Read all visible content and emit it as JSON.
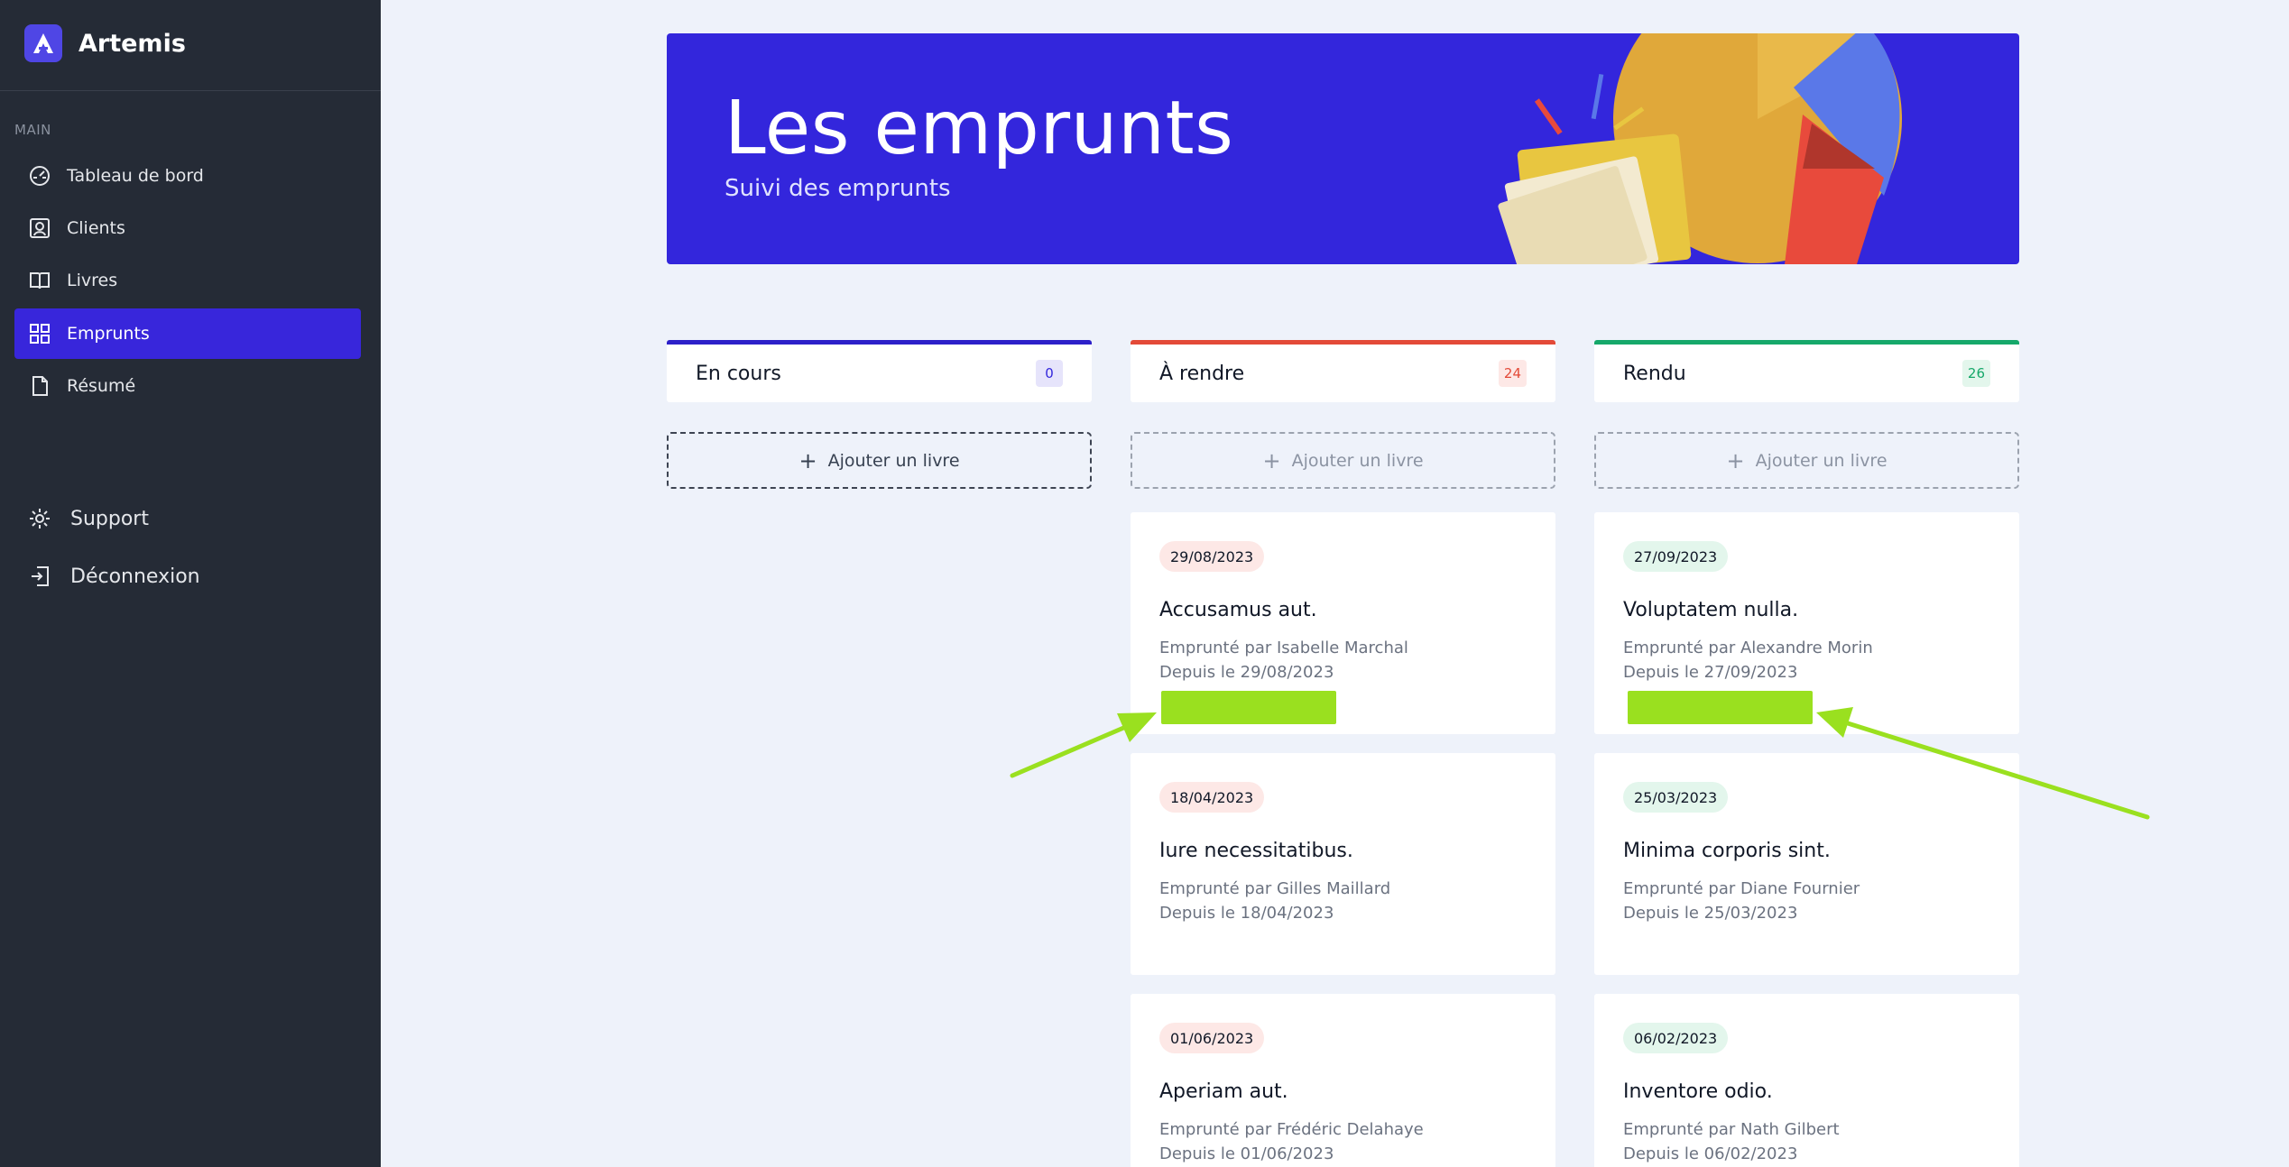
{
  "app": {
    "name": "Artemis",
    "logo_icon": "artemis-logo-icon"
  },
  "sidebar": {
    "section_label": "MAIN",
    "items": [
      {
        "label": "Tableau de bord",
        "icon": "dashboard-icon",
        "active": false
      },
      {
        "label": "Clients",
        "icon": "user-icon",
        "active": false
      },
      {
        "label": "Livres",
        "icon": "book-icon",
        "active": false
      },
      {
        "label": "Emprunts",
        "icon": "grid-icon",
        "active": true
      },
      {
        "label": "Résumé",
        "icon": "document-icon",
        "active": false
      }
    ],
    "bottom": [
      {
        "label": "Support",
        "icon": "gear-icon"
      },
      {
        "label": "Déconnexion",
        "icon": "logout-icon"
      }
    ]
  },
  "banner": {
    "title": "Les emprunts",
    "subtitle": "Suivi des emprunts"
  },
  "columns": [
    {
      "title": "En cours",
      "count": "0",
      "accent": "#2d20c9",
      "add_label": "Ajouter un livre",
      "cards": []
    },
    {
      "title": "À rendre",
      "count": "24",
      "accent": "#e34a38",
      "add_label": "Ajouter un livre",
      "cards": [
        {
          "date": "29/08/2023",
          "title": "Accusamus aut.",
          "borrowed_by": "Emprunté par Isabelle Marchal",
          "since": "Depuis le 29/08/2023"
        },
        {
          "date": "18/04/2023",
          "title": "Iure necessitatibus.",
          "borrowed_by": "Emprunté par Gilles Maillard",
          "since": "Depuis le 18/04/2023"
        },
        {
          "date": "01/06/2023",
          "title": "Aperiam aut.",
          "borrowed_by": "Emprunté par Frédéric Delahaye",
          "since": "Depuis le 01/06/2023"
        }
      ]
    },
    {
      "title": "Rendu",
      "count": "26",
      "accent": "#16a86a",
      "add_label": "Ajouter un livre",
      "cards": [
        {
          "date": "27/09/2023",
          "title": "Voluptatem nulla.",
          "borrowed_by": "Emprunté par Alexandre Morin",
          "since": "Depuis le 27/09/2023"
        },
        {
          "date": "25/03/2023",
          "title": "Minima corporis sint.",
          "borrowed_by": "Emprunté par Diane Fournier",
          "since": "Depuis le 25/03/2023"
        },
        {
          "date": "06/02/2023",
          "title": "Inventore odio.",
          "borrowed_by": "Emprunté par Nath Gilbert",
          "since": "Depuis le 06/02/2023"
        }
      ]
    }
  ],
  "colors": {
    "sidebar_bg": "#252b36",
    "primary": "#3326dc",
    "highlight": "#9ae01f"
  }
}
